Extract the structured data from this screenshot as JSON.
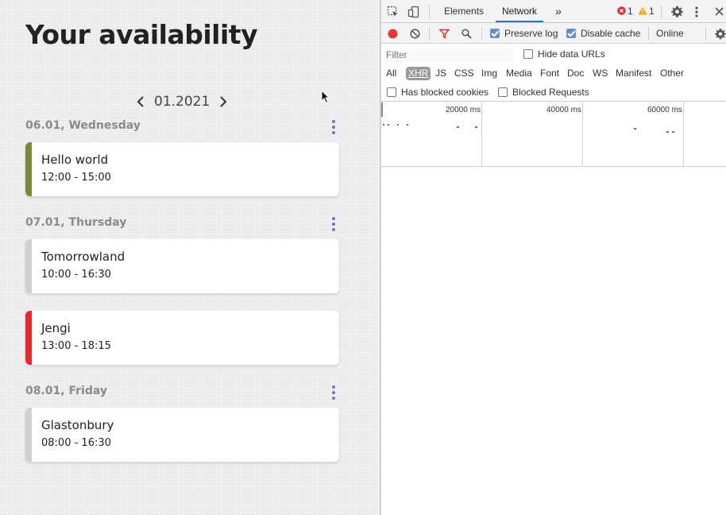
{
  "app": {
    "title": "Your availability",
    "month": "01.2021",
    "days": [
      {
        "header": "06.01, Wednesday",
        "events": [
          {
            "title": "Hello world",
            "time": "12:00 - 15:00",
            "color": "#7a8a3c"
          }
        ]
      },
      {
        "header": "07.01, Thursday",
        "events": [
          {
            "title": "Tomorrowland",
            "time": "10:00 - 16:30",
            "color": "#d0d0d0"
          },
          {
            "title": "Jengi",
            "time": "13:00 - 18:15",
            "color": "#e8282e"
          }
        ]
      },
      {
        "header": "08.01, Friday",
        "events": [
          {
            "title": "Glastonbury",
            "time": "08:00 - 16:30",
            "color": "#d0d0d0"
          }
        ]
      }
    ]
  },
  "devtools": {
    "tabs": [
      "Elements",
      "Network"
    ],
    "active_tab": "Network",
    "error_count": "1",
    "warning_count": "1",
    "toolbar": {
      "preserve_log": "Preserve log",
      "disable_cache": "Disable cache",
      "throttling": "Online"
    },
    "filter_placeholder": "Filter",
    "hide_data_urls": "Hide data URLs",
    "types": [
      "All",
      "XHR",
      "JS",
      "CSS",
      "Img",
      "Media",
      "Font",
      "Doc",
      "WS",
      "Manifest",
      "Other"
    ],
    "active_type": "XHR",
    "has_blocked_cookies": "Has blocked cookies",
    "blocked_requests": "Blocked Requests",
    "overview_ticks": [
      "20000 ms",
      "40000 ms",
      "60000 ms"
    ]
  },
  "colors": {
    "kebab": "#6a7bb8",
    "record": "#e53935",
    "filter_active": "#d93025",
    "accent": "#1a73e8"
  }
}
